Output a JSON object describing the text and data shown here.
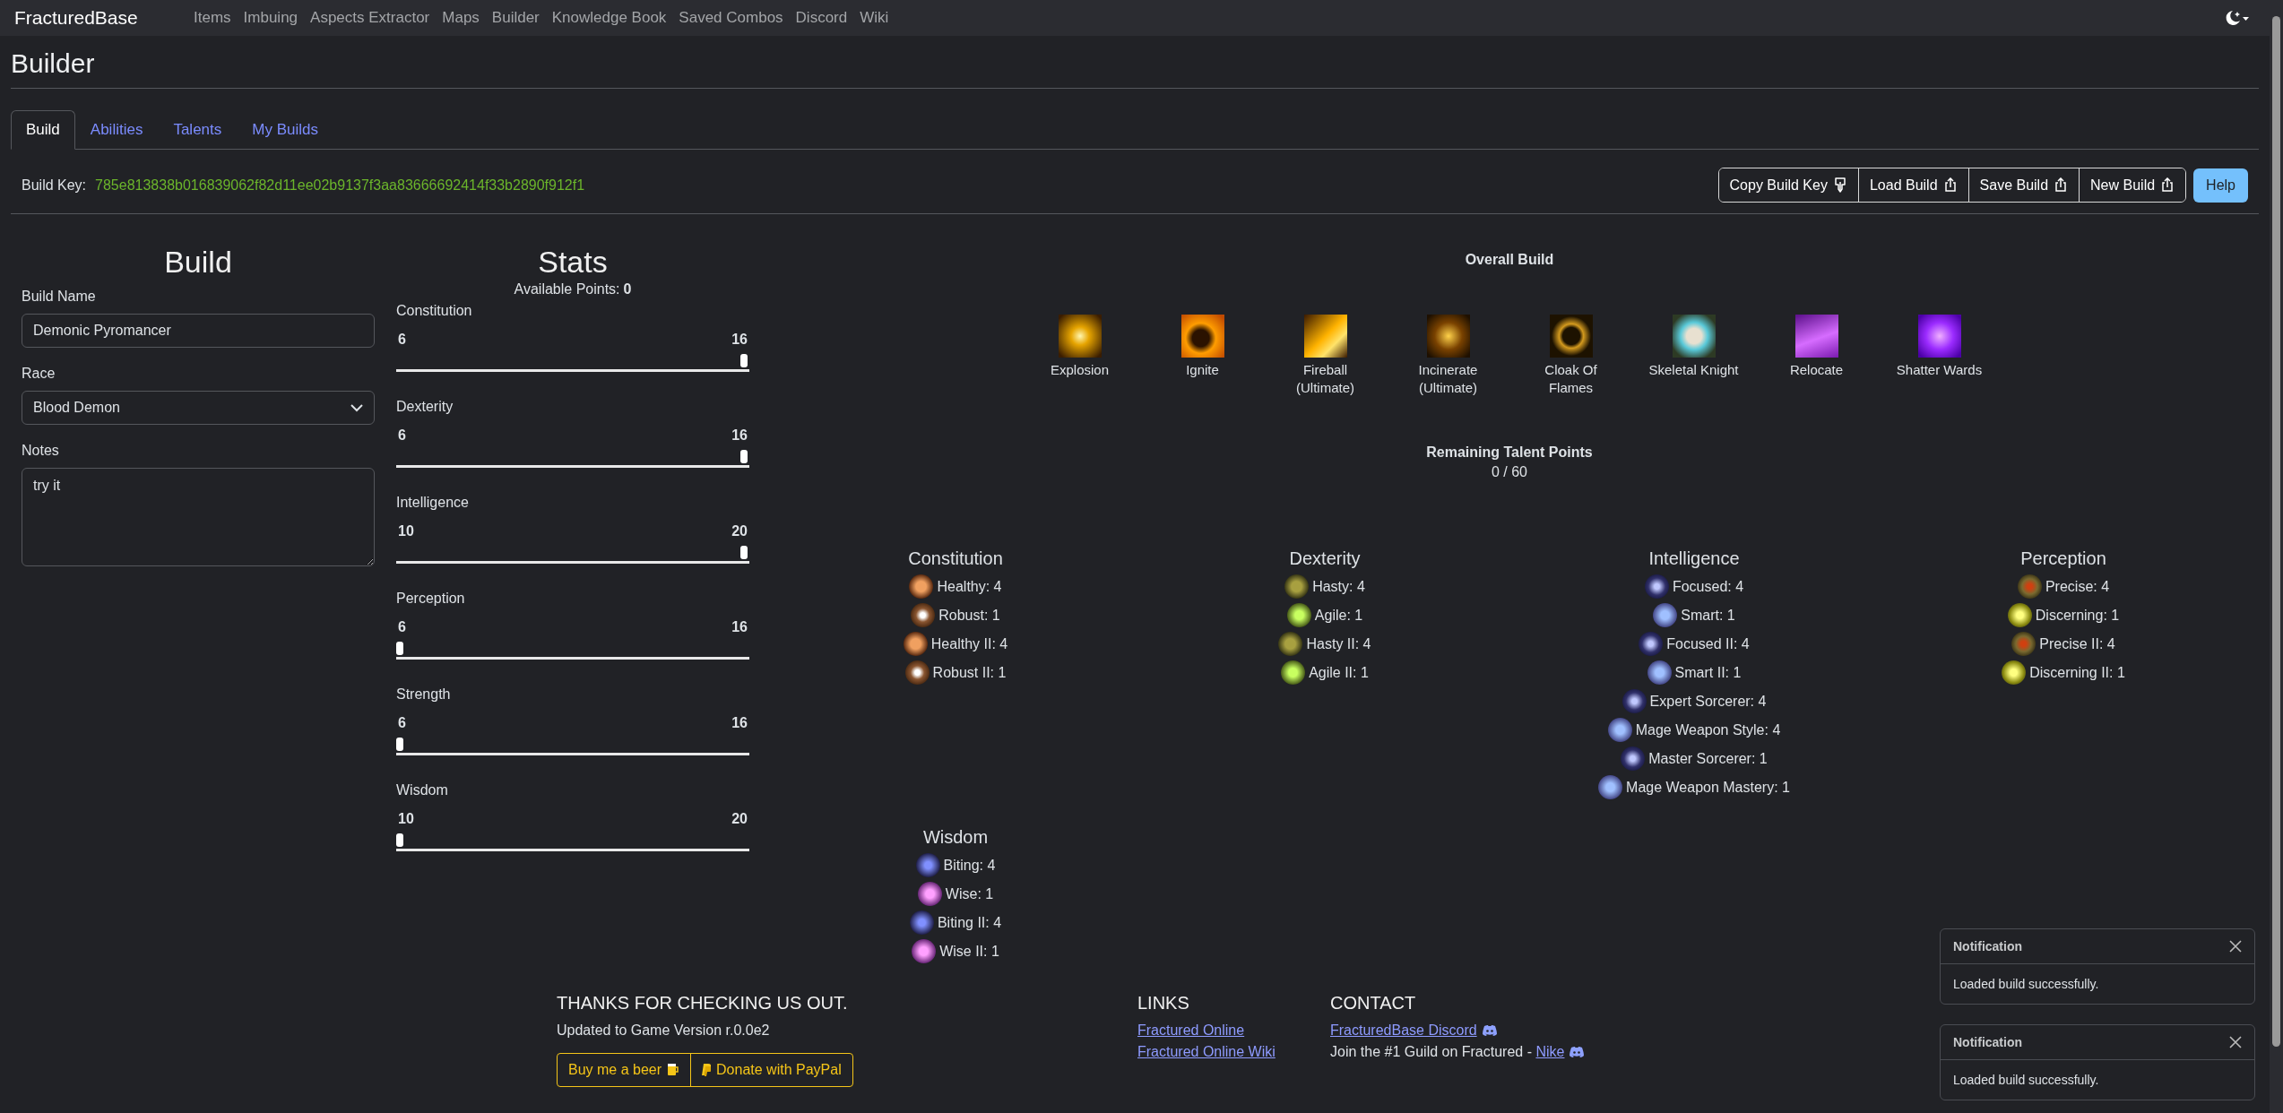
{
  "navbar": {
    "brand": "FracturedBase",
    "links": [
      "Items",
      "Imbuing",
      "Aspects Extractor",
      "Maps",
      "Builder",
      "Knowledge Book",
      "Saved Combos",
      "Discord",
      "Wiki"
    ]
  },
  "page_title": "Builder",
  "tabs": [
    {
      "label": "Build",
      "selected": true
    },
    {
      "label": "Abilities",
      "selected": false
    },
    {
      "label": "Talents",
      "selected": false
    },
    {
      "label": "My Builds",
      "selected": false
    }
  ],
  "build_key": {
    "label": "Build Key:",
    "value": "785e813838b016839062f82d11ee02b9137f3aa83666692414f33b2890f912f1"
  },
  "actions": [
    {
      "label": "Copy Build Key",
      "kind": "download"
    },
    {
      "label": "Load Build",
      "kind": "upload"
    },
    {
      "label": "Save Build",
      "kind": "upload"
    },
    {
      "label": "New Build",
      "kind": "upload"
    }
  ],
  "help_button": "Help",
  "build_form": {
    "title": "Build",
    "fields": [
      {
        "kind": "text",
        "label": "Build Name",
        "value": "Demonic Pyromancer"
      },
      {
        "kind": "select",
        "label": "Race",
        "value": "Blood Demon"
      },
      {
        "kind": "textarea",
        "label": "Notes",
        "value": "try it"
      }
    ]
  },
  "stats": {
    "title": "Stats",
    "available_label": "Available Points:",
    "available_value": "0",
    "items": [
      {
        "name": "Constitution",
        "min": "6",
        "max": "16",
        "level": 1
      },
      {
        "name": "Dexterity",
        "min": "6",
        "max": "16",
        "level": 1
      },
      {
        "name": "Intelligence",
        "min": "10",
        "max": "20",
        "level": 1
      },
      {
        "name": "Perception",
        "min": "6",
        "max": "16",
        "level": 0
      },
      {
        "name": "Strength",
        "min": "6",
        "max": "16",
        "level": 0
      },
      {
        "name": "Wisdom",
        "min": "10",
        "max": "20",
        "level": 0
      }
    ]
  },
  "overall_build": {
    "title": "Overall Build",
    "abilities": [
      {
        "name": "Explosion"
      },
      {
        "name": "Ignite"
      },
      {
        "name": "Fireball\n(Ultimate)"
      },
      {
        "name": "Incinerate\n(Ultimate)"
      },
      {
        "name": "Cloak Of\nFlames"
      },
      {
        "name": "Skeletal Knight"
      },
      {
        "name": "Relocate"
      },
      {
        "name": "Shatter Wards"
      }
    ]
  },
  "remaining_talents": {
    "title": "Remaining Talent Points",
    "value": "0 / 60"
  },
  "talent_groups": [
    {
      "name": "Constitution",
      "talents": [
        "Healthy: 4",
        "Robust: 1",
        "Healthy II: 4",
        "Robust II: 1"
      ]
    },
    {
      "name": "Dexterity",
      "talents": [
        "Hasty: 4",
        "Agile: 1",
        "Hasty II: 4",
        "Agile II: 1"
      ]
    },
    {
      "name": "Intelligence",
      "talents": [
        "Focused: 4",
        "Smart: 1",
        "Focused II: 4",
        "Smart II: 1",
        "Expert Sorcerer: 4",
        "Mage Weapon Style: 4",
        "Master Sorcerer: 1",
        "Mage Weapon Mastery: 1"
      ]
    },
    {
      "name": "Perception",
      "talents": [
        "Precise: 4",
        "Discerning: 1",
        "Precise II: 4",
        "Discerning II: 1"
      ]
    },
    {
      "name": "Wisdom",
      "talents": [
        "Biting: 4",
        "Wise: 1",
        "Biting II: 4",
        "Wise II: 1"
      ]
    }
  ],
  "footer": {
    "thanks_title": "THANKS FOR CHECKING US OUT.",
    "version": "Updated to Game Version r.0.0e2",
    "support_buttons": [
      {
        "label": "Buy me a beer",
        "kind": "beer"
      },
      {
        "label": "Donate with PayPal",
        "kind": "paypal"
      }
    ],
    "links_title": "LINKS",
    "links": [
      "Fractured Online",
      "Fractured Online Wiki"
    ],
    "contact_title": "CONTACT",
    "discord_link": "FracturedBase Discord",
    "guild_text": "Join the #1 Guild on Fractured - ",
    "guild_link": "Nike"
  },
  "notifications": [
    {
      "title": "Notification",
      "message": "Loaded build successfully."
    },
    {
      "title": "Notification",
      "message": "Loaded build successfully."
    }
  ]
}
